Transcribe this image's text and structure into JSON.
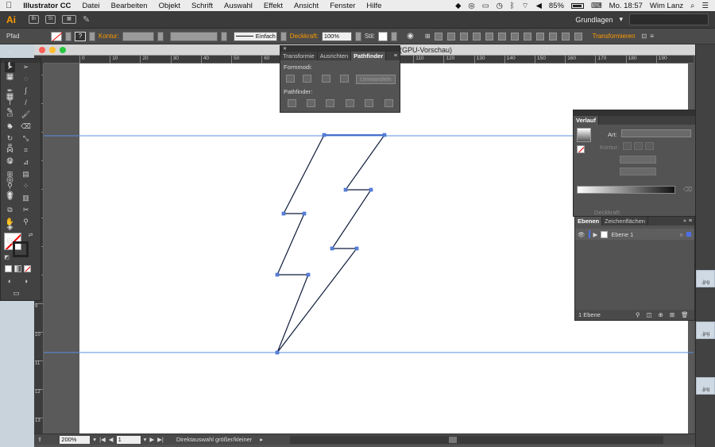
{
  "menubar": {
    "apple": "",
    "app_name": "Illustrator CC",
    "items": [
      "Datei",
      "Bearbeiten",
      "Objekt",
      "Schrift",
      "Auswahl",
      "Effekt",
      "Ansicht",
      "Fenster",
      "Hilfe"
    ],
    "battery": "85%",
    "clock": "Mo. 18:57",
    "user": "Wim Lanz"
  },
  "appbar": {
    "logo": "Ai",
    "bridge": "Br",
    "stock": "St",
    "workspace": "Grundlagen",
    "workspace_arrow": "▾"
  },
  "controlbar": {
    "object_type": "Pfad",
    "stroke_label": "Kontur:",
    "stroke_style": "Einfach",
    "opacity_label": "Deckkraft:",
    "opacity_value": "100%",
    "style_label": "Stil:",
    "transform_label": "Transformieren"
  },
  "document": {
    "title_fragment": "(GPU-Vorschau)",
    "ruler_h": [
      "0",
      "10",
      "20",
      "30",
      "40",
      "50",
      "60",
      "70",
      "80",
      "90",
      "100",
      "110",
      "120",
      "130",
      "140",
      "150",
      "160",
      "170",
      "180",
      "190"
    ],
    "ruler_v": [
      "1",
      "2",
      "3",
      "4",
      "5",
      "6",
      "7",
      "8",
      "9",
      "10",
      "11",
      "12",
      "13"
    ],
    "status_zoom": "200%",
    "status_artboard": "1",
    "status_tool": "Direktauswahl größer/kleiner"
  },
  "pathfinder_panel": {
    "tabs": [
      "Transformie",
      "Ausrichten",
      "Pathfinder"
    ],
    "shape_modes_label": "Formmodi:",
    "expand_button": "Umwandeln",
    "pathfinder_label": "Pathfinder:"
  },
  "gradient_panel": {
    "title": "Verlauf",
    "type_label": "Art:",
    "stroke_label": "Kontur:",
    "opacity_label": "Deckkraft:"
  },
  "layers_panel": {
    "tabs": [
      "Ebenen",
      "Zeichenflächen"
    ],
    "layer_name": "Ebene 1",
    "footer_count": "1 Ebene",
    "layer_color": "#4f6fe6"
  },
  "desktop": {
    "file_labels": [
      ".jpg",
      ".jpg",
      ".jpg"
    ]
  },
  "colors": {
    "accent_orange": "#ff9a00",
    "guide_blue": "#5b8fe0",
    "path_stroke": "#0e1b3a"
  }
}
